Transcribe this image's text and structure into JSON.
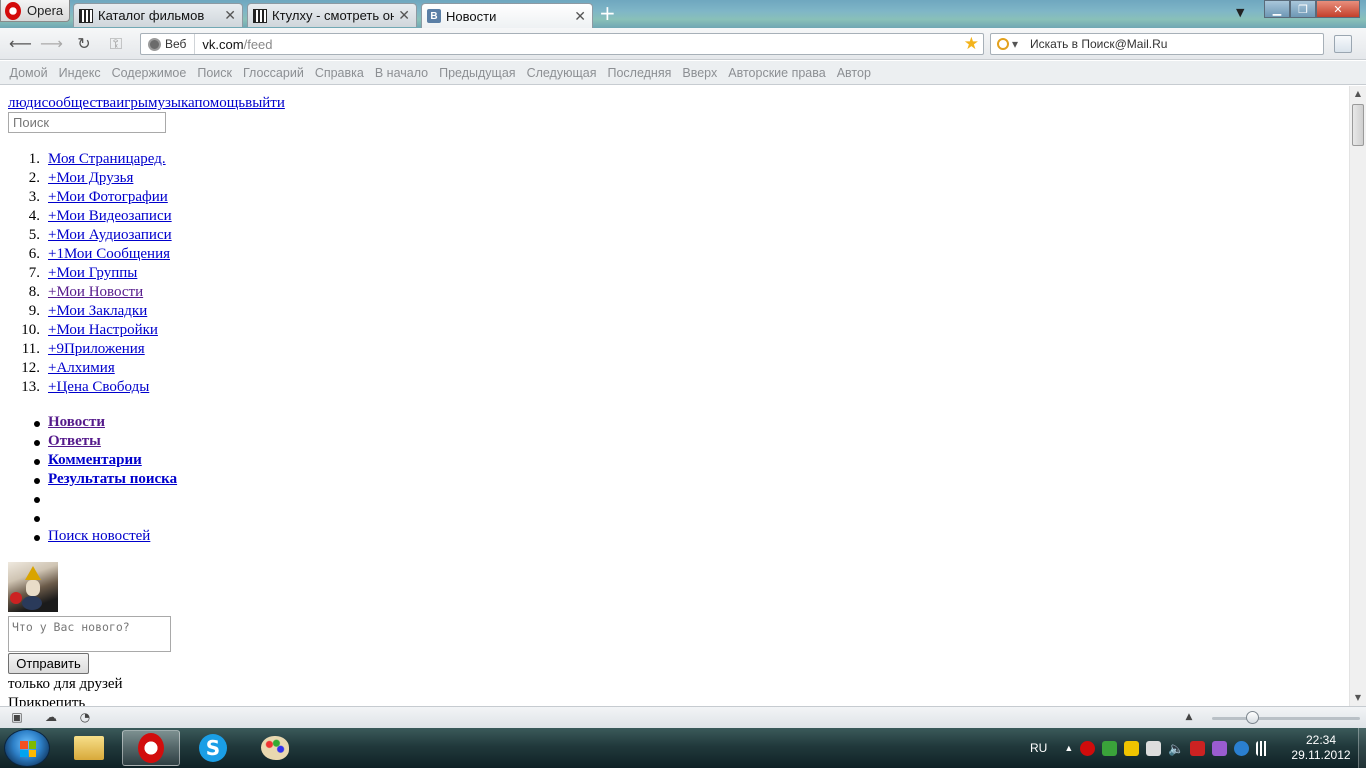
{
  "browser": {
    "menu_label": "Opera",
    "tabs": [
      {
        "title": "Каталог фильмов",
        "active": false
      },
      {
        "title": "Ктулху - смотреть онл...",
        "active": false
      },
      {
        "title": "Новости",
        "active": true
      }
    ],
    "address": {
      "badge": "Веб",
      "url_host": "vk.com",
      "url_path": "/feed"
    },
    "search_placeholder": "Искать в Поиск@Mail.Ru"
  },
  "linkbar": [
    "Домой",
    "Индекс",
    "Содержимое",
    "Поиск",
    "Глоссарий",
    "Справка",
    "В начало",
    "Предыдущая",
    "Следующая",
    "Последняя",
    "Вверх",
    "Авторские права",
    "Автор"
  ],
  "page": {
    "topnav": "людисообществаигрымузыкапомощьвыйти",
    "search_placeholder": "Поиск",
    "menu": [
      {
        "num": "1.",
        "label": "Моя Страницаред.",
        "visited": false
      },
      {
        "num": "2.",
        "label": "+Мои Друзья",
        "visited": false
      },
      {
        "num": "3.",
        "label": "+Мои Фотографии",
        "visited": false
      },
      {
        "num": "4.",
        "label": "+Мои Видеозаписи",
        "visited": false
      },
      {
        "num": "5.",
        "label": "+Мои Аудиозаписи",
        "visited": false
      },
      {
        "num": "6.",
        "label": "+1Мои Сообщения",
        "visited": false
      },
      {
        "num": "7.",
        "label": "+Мои Группы",
        "visited": false
      },
      {
        "num": "8.",
        "label": "+Мои Новости",
        "visited": true
      },
      {
        "num": "9.",
        "label": "+Мои Закладки",
        "visited": false
      },
      {
        "num": "10.",
        "label": "+Мои Настройки",
        "visited": false
      },
      {
        "num": "11.",
        "label": "+9Приложения",
        "visited": false
      },
      {
        "num": "12.",
        "label": "+Алхимия",
        "visited": false
      },
      {
        "num": "13.",
        "label": "+Цена Свободы",
        "visited": false
      }
    ],
    "feed_tabs": [
      {
        "label": "Новости",
        "visited": true
      },
      {
        "label": "Ответы",
        "visited": true
      },
      {
        "label": "Комментарии",
        "visited": false
      },
      {
        "label": "Результаты поиска",
        "visited": false
      },
      {
        "label": "",
        "visited": false
      },
      {
        "label": "",
        "visited": false
      },
      {
        "label": "Поиск новостей",
        "visited": false
      }
    ],
    "post_placeholder": "Что у Вас нового?",
    "send_label": "Отправить",
    "friends_only": "только для друзей",
    "attach": "Прикрепить"
  },
  "taskbar": {
    "language": "RU",
    "time": "22:34",
    "date": "29.11.2012"
  },
  "colors": {
    "link": "#0000cc",
    "visited": "#551a8b"
  }
}
